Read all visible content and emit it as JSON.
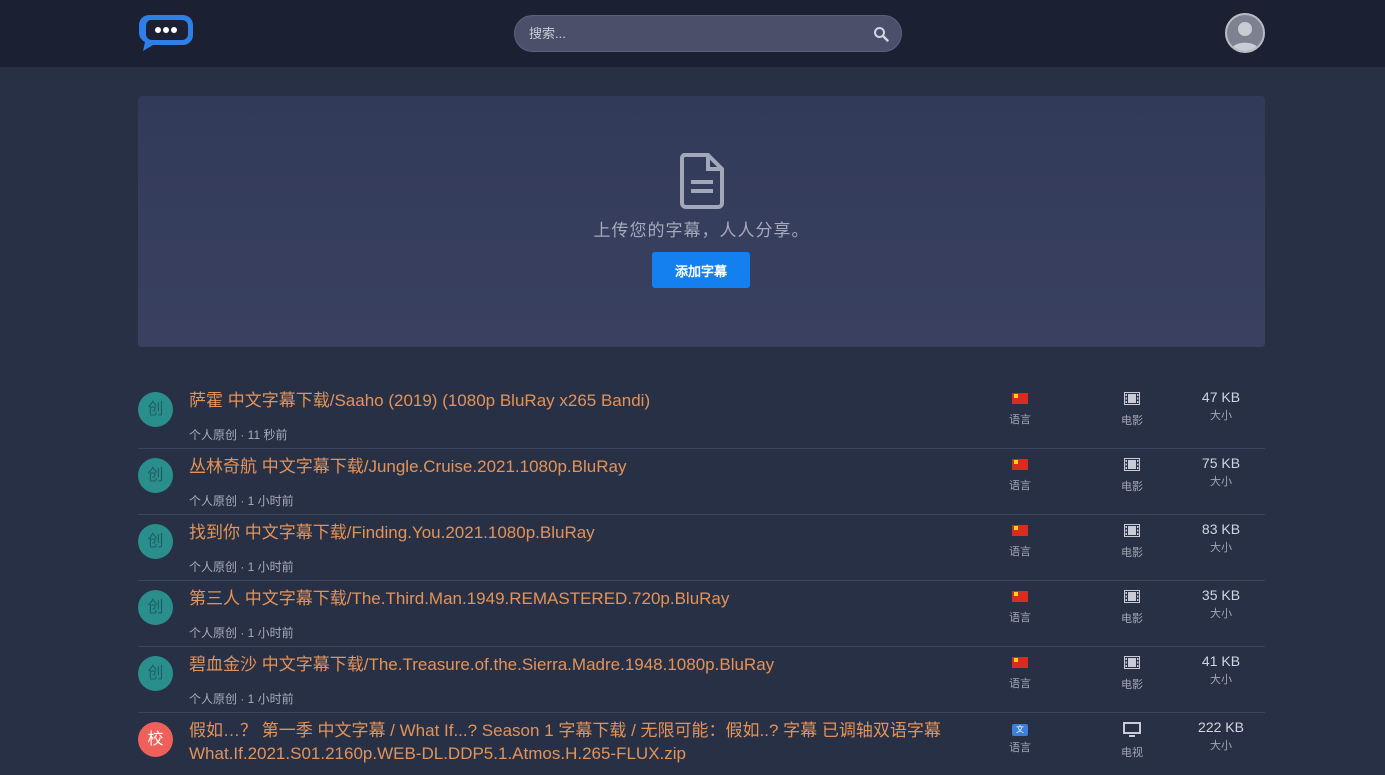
{
  "header": {
    "search_placeholder": "搜索..."
  },
  "hero": {
    "text": "上传您的字幕，人人分享。",
    "button_label": "添加字幕"
  },
  "labels": {
    "language": "语言",
    "size": "大小"
  },
  "rows": [
    {
      "badge": "创",
      "badge_color": "#2a8f8c",
      "title": "萨霍 中文字幕下载/Saaho (2019) (1080p BluRay x265 Bandi)",
      "meta": "个人原创 · 11 秒前",
      "lang_icon": "china-flag-icon",
      "type_icon": "film-icon",
      "type_label": "电影",
      "size": "47 KB"
    },
    {
      "badge": "创",
      "badge_color": "#2a8f8c",
      "title": "丛林奇航 中文字幕下载/Jungle.Cruise.2021.1080p.BluRay",
      "meta": "个人原创 · 1 小时前",
      "lang_icon": "china-flag-icon",
      "type_icon": "film-icon",
      "type_label": "电影",
      "size": "75 KB"
    },
    {
      "badge": "创",
      "badge_color": "#2a8f8c",
      "title": "找到你 中文字幕下载/Finding.You.2021.1080p.BluRay",
      "meta": "个人原创 · 1 小时前",
      "lang_icon": "china-flag-icon",
      "type_icon": "film-icon",
      "type_label": "电影",
      "size": "83 KB"
    },
    {
      "badge": "创",
      "badge_color": "#2a8f8c",
      "title": "第三人 中文字幕下载/The.Third.Man.1949.REMASTERED.720p.BluRay",
      "meta": "个人原创 · 1 小时前",
      "lang_icon": "china-flag-icon",
      "type_icon": "film-icon",
      "type_label": "电影",
      "size": "35 KB"
    },
    {
      "badge": "创",
      "badge_color": "#2a8f8c",
      "title": "碧血金沙 中文字幕下载/The.Treasure.of.the.Sierra.Madre.1948.1080p.BluRay",
      "meta": "个人原创 · 1 小时前",
      "lang_icon": "china-flag-icon",
      "type_icon": "film-icon",
      "type_label": "电影",
      "size": "41 KB"
    },
    {
      "badge": "校",
      "badge_color": "#f0605b",
      "title": "假如…？ 第一季 中文字幕 / What If...? Season 1 字幕下载 / 无限可能：假如..? 字幕 已调轴双语字幕What.If.2021.S01.2160p.WEB-DL.DDP5.1.Atmos.H.265-FLUX.zip",
      "meta": "",
      "lang_icon": "translate-icon",
      "type_icon": "tv-icon",
      "type_label": "电视",
      "size": "222 KB"
    }
  ]
}
